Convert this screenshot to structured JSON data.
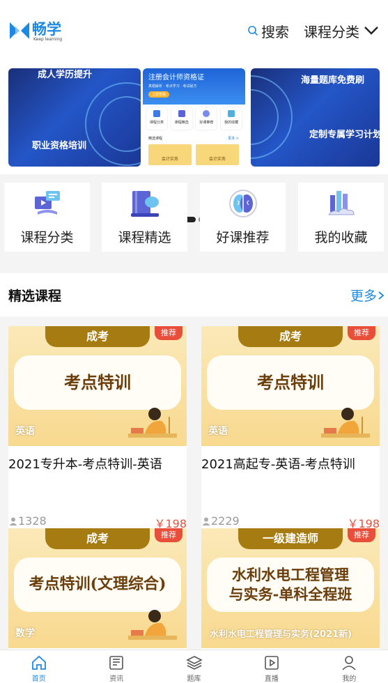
{
  "header": {
    "logo_brand": "畅学",
    "logo_tagline": "Keep learning",
    "search_label": "搜索",
    "category_label": "课程分类"
  },
  "banner": {
    "left_captions": [
      "成人学历提升",
      "职业资格培训"
    ],
    "right_captions": [
      "海量题库免费刷",
      "定制专属学习计划"
    ],
    "phone": {
      "title": "注册会计师资格证",
      "subtitle": "真题解析 · 考点学习 · 考试秘方",
      "button": "立即查看",
      "grid": [
        "课程分类",
        "课程精选",
        "好课推荐",
        "我的收藏"
      ],
      "section": "精选课程",
      "more": "更多 >",
      "cards": [
        "会计实务",
        "会计实务"
      ]
    },
    "active_index": 0,
    "slide_count": 2
  },
  "quick_entries": [
    {
      "label": "课程分类",
      "icon": "course-category-icon"
    },
    {
      "label": "课程精选",
      "icon": "course-selection-icon"
    },
    {
      "label": "好课推荐",
      "icon": "recommend-brain-icon"
    },
    {
      "label": "我的收藏",
      "icon": "my-favorites-icon"
    }
  ],
  "section": {
    "title": "精选课程",
    "more": "更多"
  },
  "courses": [
    {
      "tag": "成考",
      "headline": "考点特训",
      "subject": "英语",
      "badge": "推荐",
      "title": "2021专升本-考点特训-英语",
      "views": "1328",
      "price": "￥198"
    },
    {
      "tag": "成考",
      "headline": "考点特训",
      "subject": "英语",
      "badge": "推荐",
      "title": "2021高起专-英语-考点特训",
      "views": "2229",
      "price": "￥198"
    },
    {
      "tag": "成考",
      "headline": "考点特训(文理综合)",
      "subject": "数学",
      "badge": "推荐",
      "title": "",
      "views": "",
      "price": ""
    },
    {
      "tag": "一级建造师",
      "headline_lines": [
        "水利水电工程管理",
        "与实务-单科全程班"
      ],
      "subject": "水利水电工程管理与实务(2021新)",
      "badge": "推荐",
      "title": "",
      "views": "",
      "price": ""
    }
  ],
  "tabbar": [
    {
      "label": "首页",
      "icon": "home-icon",
      "active": true
    },
    {
      "label": "资讯",
      "icon": "news-icon",
      "active": false
    },
    {
      "label": "题库",
      "icon": "question-bank-icon",
      "active": false
    },
    {
      "label": "直播",
      "icon": "live-icon",
      "active": false
    },
    {
      "label": "我的",
      "icon": "profile-icon",
      "active": false
    }
  ],
  "colors": {
    "accent": "#1e88e5",
    "price": "#e94e3b",
    "banner": "#2456c7",
    "card_bg": "#f8d98f"
  }
}
